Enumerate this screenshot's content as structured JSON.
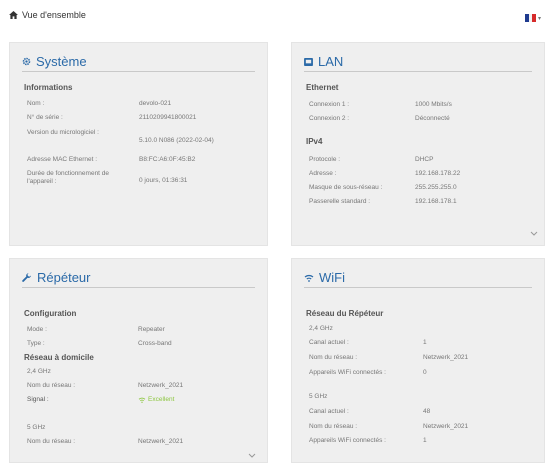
{
  "header": {
    "title": "Vue d'ensemble",
    "language": "FR"
  },
  "colors": {
    "accent": "#2b6aa8",
    "excellent": "#8cc63f",
    "card_bg": "#efefef"
  },
  "systeme": {
    "title": "Système",
    "section": "Informations",
    "rows": [
      {
        "label": "Nom :",
        "value": "devolo-021"
      },
      {
        "label": "N° de série :",
        "value": "2110209941800021"
      },
      {
        "label": "Version du micrologiciel :",
        "value": "5.10.0 N086 (2022-02-04)"
      },
      {
        "label": "Adresse MAC Ethernet :",
        "value": "B8:FC:A6:0F:45:B2"
      },
      {
        "label": "Durée de fonctionnement de l'appareil :",
        "value": "0 jours, 01:36:31"
      }
    ]
  },
  "lan": {
    "title": "LAN",
    "ethernet_title": "Ethernet",
    "ethernet": [
      {
        "label": "Connexion 1 :",
        "value": "1000 Mbits/s"
      },
      {
        "label": "Connexion 2 :",
        "value": "Déconnecté"
      }
    ],
    "ipv4_title": "IPv4",
    "ipv4": [
      {
        "label": "Protocole :",
        "value": "DHCP"
      },
      {
        "label": "Adresse :",
        "value": "192.168.178.22"
      },
      {
        "label": "Masque de sous-réseau :",
        "value": "255.255.255.0"
      },
      {
        "label": "Passerelle standard :",
        "value": "192.168.178.1"
      }
    ]
  },
  "repeteur": {
    "title": "Répéteur",
    "config_title": "Configuration",
    "config": [
      {
        "label": "Mode :",
        "value": "Repeater"
      },
      {
        "label": "Type :",
        "value": "Cross-band"
      }
    ],
    "home_title": "Réseau à domicile",
    "band_24": "2,4 GHz",
    "home_24": [
      {
        "label": "Nom du réseau :",
        "value": "Netzwerk_2021"
      }
    ],
    "signal_label": "Signal :",
    "signal_value": "Excellent",
    "band_5": "5 GHz",
    "home_5": [
      {
        "label": "Nom du réseau :",
        "value": "Netzwerk_2021"
      }
    ]
  },
  "wifi": {
    "title": "WiFi",
    "section": "Réseau du Répéteur",
    "band_24": "2,4 GHz",
    "rows_24": [
      {
        "label": "Canal actuel :",
        "value": "1"
      },
      {
        "label": "Nom du réseau :",
        "value": "Netzwerk_2021"
      },
      {
        "label": "Appareils WiFi connectés :",
        "value": "0"
      }
    ],
    "band_5": "5 GHz",
    "rows_5": [
      {
        "label": "Canal actuel :",
        "value": "48"
      },
      {
        "label": "Nom du réseau :",
        "value": "Netzwerk_2021"
      },
      {
        "label": "Appareils WiFi connectés :",
        "value": "1"
      }
    ]
  }
}
